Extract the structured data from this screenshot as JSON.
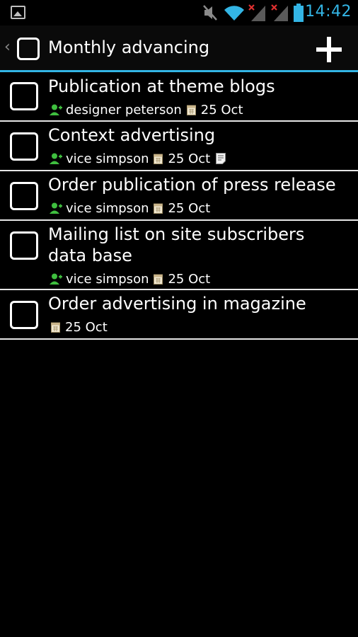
{
  "status_bar": {
    "time": "14:42",
    "icons": [
      "gallery-icon",
      "mute-icon",
      "wifi-icon",
      "signal-no-service-icon",
      "signal-no-service-icon",
      "battery-icon"
    ],
    "accent": "#33b5e5"
  },
  "action_bar": {
    "title": "Monthly advancing",
    "add_icon": "plus-icon",
    "divider_color": "#33b5e5"
  },
  "tasks": [
    {
      "title": "Publication at theme blogs",
      "assignee": "designer peterson",
      "date": "25 Oct",
      "has_note": false,
      "checked": false
    },
    {
      "title": "Context advertising",
      "assignee": "vice simpson",
      "date": "25 Oct",
      "has_note": true,
      "checked": false
    },
    {
      "title": "Order publication of press release",
      "assignee": "vice simpson",
      "date": "25 Oct",
      "has_note": false,
      "checked": false
    },
    {
      "title": "Mailing list on site subscribers data base",
      "assignee": "vice simpson",
      "date": "25 Oct",
      "has_note": false,
      "checked": false
    },
    {
      "title": "Order advertising in magazine",
      "assignee": "",
      "date": "25 Oct",
      "has_note": false,
      "checked": false
    }
  ],
  "colors": {
    "assignee_icon": "#3fbf3f",
    "calendar_icon": "#c9b48a"
  }
}
